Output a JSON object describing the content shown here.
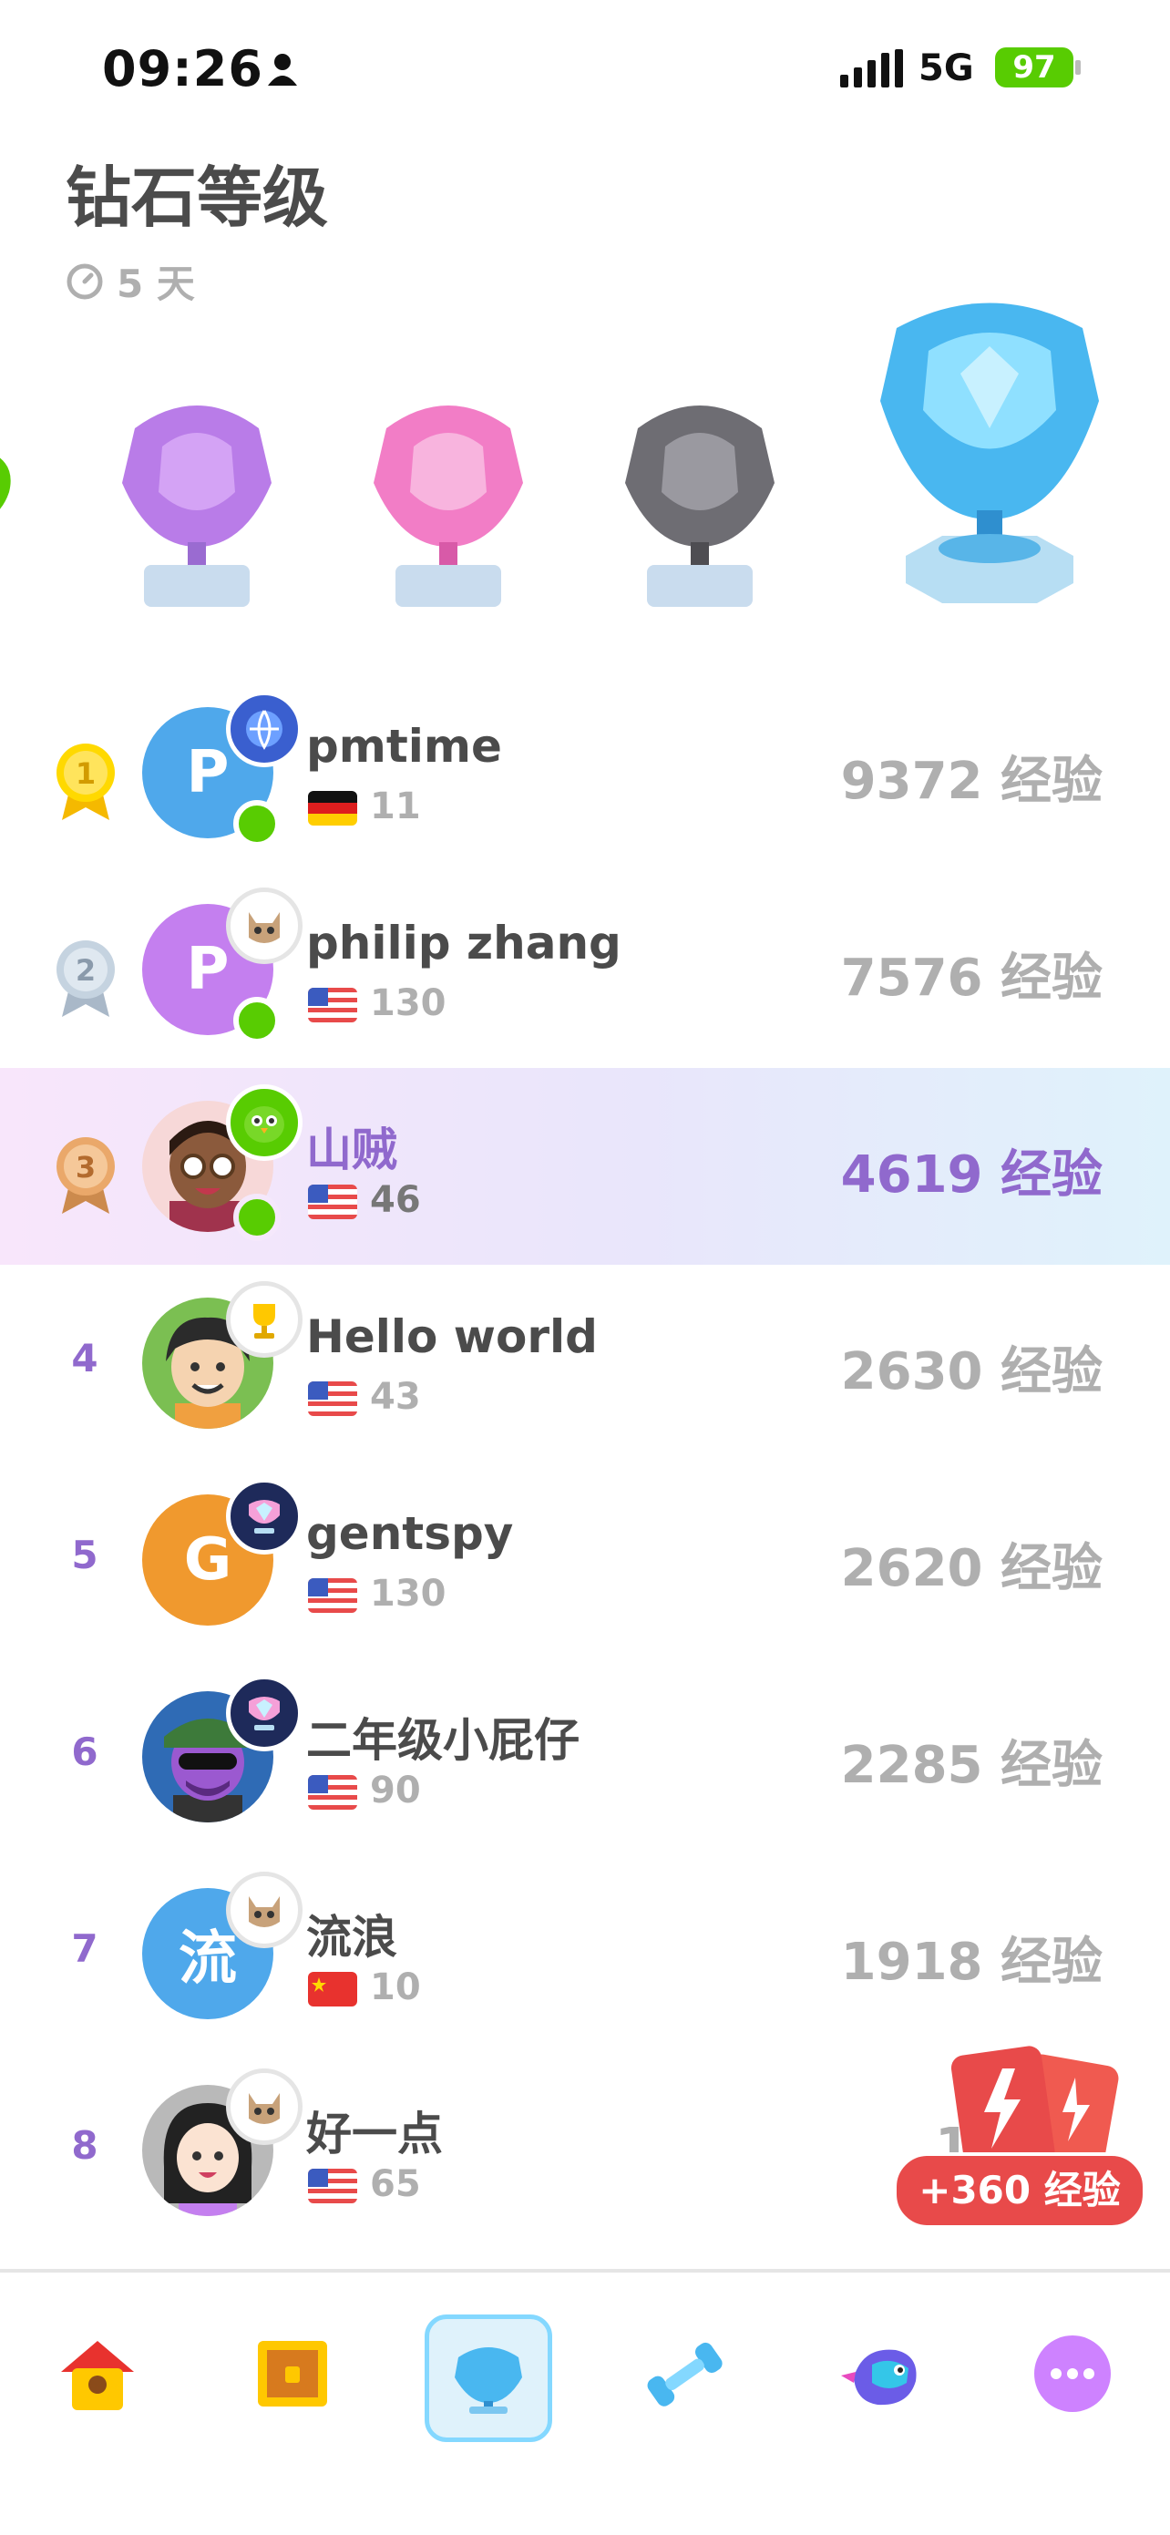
{
  "status_bar": {
    "time": "09:26",
    "network": "5G",
    "battery": "97"
  },
  "header": {
    "title": "钻石等级",
    "timer": "5 天"
  },
  "leaderboard": [
    {
      "rank": "1",
      "name": "pmtime",
      "avatar_letter": "P",
      "avatar_color": "#4fa8eb",
      "streak": "11",
      "flag": "de",
      "xp": "9372 经验",
      "online": true
    },
    {
      "rank": "2",
      "name": "philip zhang",
      "avatar_letter": "P",
      "avatar_color": "#c47fef",
      "streak": "130",
      "flag": "us",
      "xp": "7576 经验",
      "online": true
    },
    {
      "rank": "3",
      "name": "山贼",
      "avatar_letter": "",
      "avatar_color": "#f7d8d8",
      "streak": "46",
      "flag": "us",
      "xp": "4619 经验",
      "online": true,
      "me": true
    },
    {
      "rank": "4",
      "name": "Hello world",
      "avatar_letter": "",
      "avatar_color": "#7bbf52",
      "streak": "43",
      "flag": "us",
      "xp": "2630 经验"
    },
    {
      "rank": "5",
      "name": "gentspy",
      "avatar_letter": "G",
      "avatar_color": "#f0992e",
      "streak": "130",
      "flag": "us",
      "xp": "2620 经验"
    },
    {
      "rank": "6",
      "name": "二年级小屁仔",
      "avatar_letter": "",
      "avatar_color": "#2f6bb5",
      "streak": "90",
      "flag": "us",
      "xp": "2285 经验"
    },
    {
      "rank": "7",
      "name": "流浪",
      "avatar_letter": "流",
      "avatar_color": "#4fa8eb",
      "streak": "10",
      "flag": "cn",
      "xp": "1918 经验"
    },
    {
      "rank": "8",
      "name": "好一点",
      "avatar_letter": "",
      "avatar_color": "#b9b9b9",
      "streak": "65",
      "flag": "us",
      "xp": "18"
    }
  ],
  "reward": {
    "label": "+360 经验"
  },
  "icons": {
    "nav": [
      "home-icon",
      "chest-icon",
      "league-icon",
      "dumbbell-icon",
      "duo-bird-icon",
      "more-icon"
    ]
  },
  "colors": {
    "accent_purple": "#9069cd",
    "online_green": "#58cc02",
    "reward_red": "#e84a4a",
    "active_blue": "#84d8ff"
  }
}
